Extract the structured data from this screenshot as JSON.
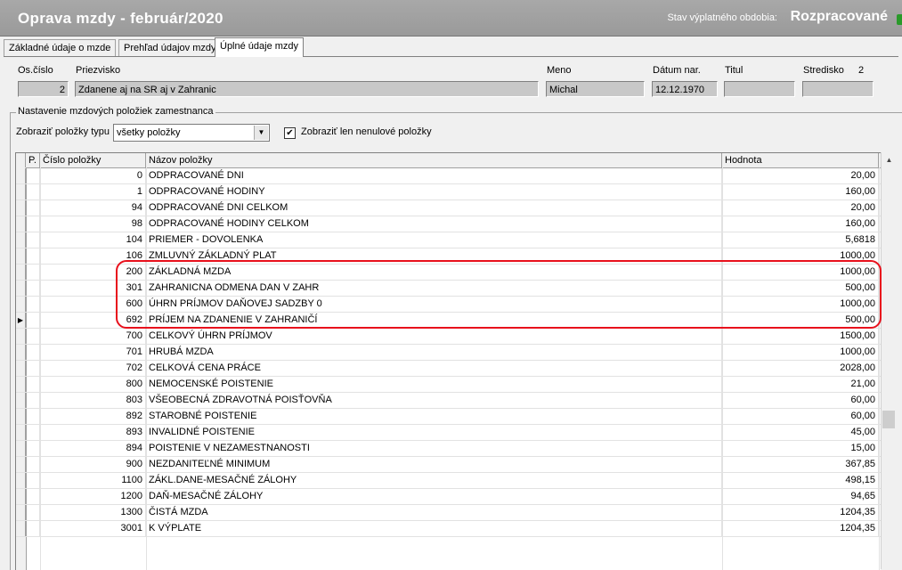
{
  "window": {
    "title": "Oprava mzdy -  február/2020",
    "status_label": "Stav výplatného obdobia:",
    "status_value": "Rozpracované"
  },
  "tabs": [
    {
      "label": "Základné údaje o mzde"
    },
    {
      "label": "Prehľad údajov mzdy"
    },
    {
      "label": "Úplné údaje mzdy"
    }
  ],
  "employee": {
    "labels": {
      "os_cislo": "Os.číslo",
      "priezvisko": "Priezvisko",
      "meno": "Meno",
      "datum_nar": "Dátum nar.",
      "titul": "Titul",
      "stredisko": "Stredisko"
    },
    "os_cislo": "2",
    "priezvisko": "Zdanene aj na SR aj v Zahranic",
    "meno": "Michal",
    "datum_nar": "12.12.1970",
    "titul": "",
    "stredisko": "2",
    "stredisko_field": ""
  },
  "settings": {
    "group_title": "Nastavenie mzdových položiek zamestnanca",
    "filter_label": "Zobraziť položky typu",
    "filter_value": "všetky položky",
    "checkbox_label": "Zobraziť len nenulové položky",
    "checkbox_checked": true,
    "check_mark": "✔"
  },
  "grid": {
    "columns": {
      "p": "P.",
      "cislo": "Číslo položky",
      "nazov": "Názov položky",
      "hodnota": "Hodnota"
    },
    "current_row_marker": "▶",
    "rows": [
      {
        "cislo": "0",
        "nazov": "ODPRACOVANÉ DNI",
        "hodnota": "20,00"
      },
      {
        "cislo": "1",
        "nazov": "ODPRACOVANÉ HODINY",
        "hodnota": "160,00"
      },
      {
        "cislo": "94",
        "nazov": "ODPRACOVANÉ DNI CELKOM",
        "hodnota": "20,00"
      },
      {
        "cislo": "98",
        "nazov": "ODPRACOVANÉ HODINY CELKOM",
        "hodnota": "160,00"
      },
      {
        "cislo": "104",
        "nazov": "PRIEMER - DOVOLENKA",
        "hodnota": "5,6818"
      },
      {
        "cislo": "106",
        "nazov": "ZMLUVNÝ ZÁKLADNÝ PLAT",
        "hodnota": "1000,00"
      },
      {
        "cislo": "200",
        "nazov": "ZÁKLADNÁ MZDA",
        "hodnota": "1000,00"
      },
      {
        "cislo": "301",
        "nazov": "ZAHRANICNA ODMENA DAN V ZAHR",
        "hodnota": "500,00"
      },
      {
        "cislo": "600",
        "nazov": "ÚHRN PRÍJMOV DAŇOVEJ SADZBY 0",
        "hodnota": "1000,00"
      },
      {
        "cislo": "692",
        "nazov": "PRÍJEM NA ZDANENIE V ZAHRANIČÍ",
        "hodnota": "500,00",
        "current": true
      },
      {
        "cislo": "700",
        "nazov": "CELKOVÝ ÚHRN PRÍJMOV",
        "hodnota": "1500,00"
      },
      {
        "cislo": "701",
        "nazov": "HRUBÁ MZDA",
        "hodnota": "1000,00"
      },
      {
        "cislo": "702",
        "nazov": "CELKOVÁ CENA PRÁCE",
        "hodnota": "2028,00"
      },
      {
        "cislo": "800",
        "nazov": "NEMOCENSKÉ POISTENIE",
        "hodnota": "21,00"
      },
      {
        "cislo": "803",
        "nazov": "VŠEOBECNÁ ZDRAVOTNÁ POISŤOVŇA",
        "hodnota": "60,00"
      },
      {
        "cislo": "892",
        "nazov": "STAROBNÉ POISTENIE",
        "hodnota": "60,00"
      },
      {
        "cislo": "893",
        "nazov": "INVALIDNÉ POISTENIE",
        "hodnota": "45,00"
      },
      {
        "cislo": "894",
        "nazov": "POISTENIE V NEZAMESTNANOSTI",
        "hodnota": "15,00"
      },
      {
        "cislo": "900",
        "nazov": "NEZDANITEĽNÉ MINIMUM",
        "hodnota": "367,85"
      },
      {
        "cislo": "1100",
        "nazov": "ZÁKL.DANE-MESAČNÉ ZÁLOHY",
        "hodnota": "498,15"
      },
      {
        "cislo": "1200",
        "nazov": "DAŇ-MESAČNÉ ZÁLOHY",
        "hodnota": "94,65"
      },
      {
        "cislo": "1300",
        "nazov": "ČISTÁ MZDA",
        "hodnota": "1204,35"
      },
      {
        "cislo": "3001",
        "nazov": "K VÝPLATE",
        "hodnota": "1204,35"
      }
    ]
  },
  "colors": {
    "highlight": "#e8101c",
    "status_light": "#2a9a2a"
  }
}
